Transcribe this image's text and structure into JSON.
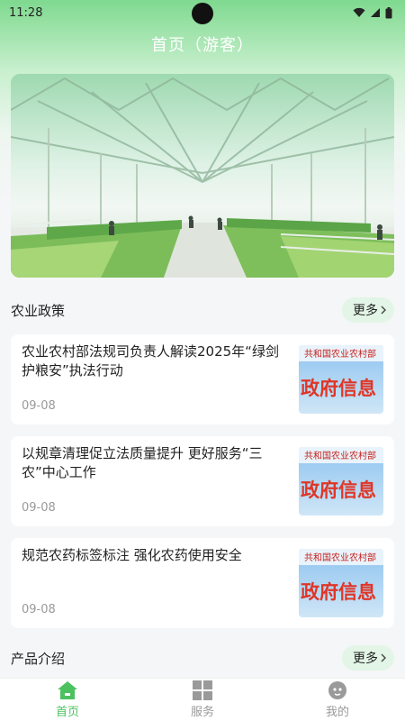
{
  "status": {
    "time": "11:28"
  },
  "header": {
    "title": "首页（游客）"
  },
  "banner": {
    "image": "greenhouse-photo"
  },
  "policy": {
    "title": "农业政策",
    "more_label": "更多",
    "items": [
      {
        "title": "农业农村部法规司负责人解读2025年“绿剑护粮安”执法行动",
        "date": "09-08"
      },
      {
        "title": "以规章清理促立法质量提升 更好服务“三农”中心工作",
        "date": "09-08"
      },
      {
        "title": "规范农药标签标注 强化农药使用安全",
        "date": "09-08"
      }
    ],
    "thumb_top": "共和国农业农村部",
    "thumb_main": "政府信息"
  },
  "products": {
    "title": "产品介绍",
    "more_label": "更多"
  },
  "nav": {
    "home": "首页",
    "service": "服务",
    "mine": "我的"
  },
  "colors": {
    "accent": "#4cc160",
    "header_gradient_top": "#7fd98f"
  }
}
